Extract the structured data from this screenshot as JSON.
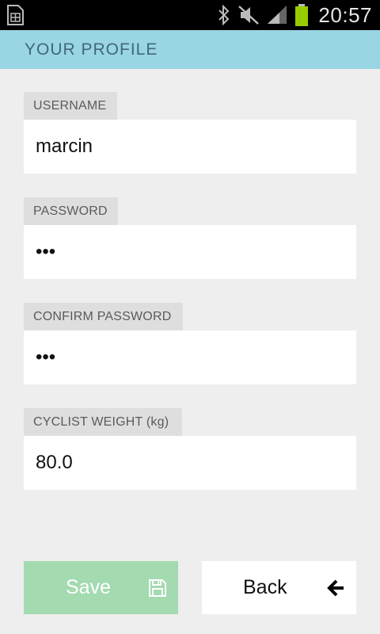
{
  "status_bar": {
    "time": "20:57",
    "icons": [
      "sim-card-icon",
      "bluetooth-icon",
      "mute-icon",
      "signal-icon",
      "battery-icon"
    ],
    "battery_color": "#99cc00"
  },
  "header": {
    "title": "YOUR PROFILE",
    "background": "#99d5e2"
  },
  "form": {
    "username": {
      "label": "USERNAME",
      "value": "marcin"
    },
    "password": {
      "label": "PASSWORD",
      "value": "•••"
    },
    "confirm_password": {
      "label": "CONFIRM PASSWORD",
      "value": "•••"
    },
    "cyclist_weight": {
      "label": "CYCLIST WEIGHT (kg)",
      "value": "80.0"
    }
  },
  "buttons": {
    "save": {
      "label": "Save",
      "icon": "save-icon",
      "color": "#a3dab0"
    },
    "back": {
      "label": "Back",
      "icon": "arrow-left-icon"
    }
  }
}
